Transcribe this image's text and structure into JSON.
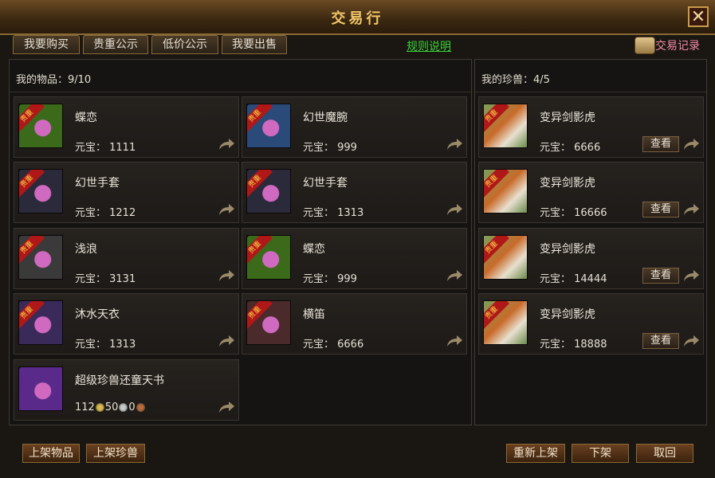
{
  "window": {
    "title": "交易行",
    "close_label": "✕"
  },
  "tabs": [
    {
      "label": "我要购买"
    },
    {
      "label": "贵重公示"
    },
    {
      "label": "低价公示"
    },
    {
      "label": "我要出售"
    }
  ],
  "rules_label": "规则说明",
  "records_label": "交易记录",
  "my_items": {
    "header": "我的物品：9/10",
    "items": [
      {
        "name": "蝶恋",
        "price": "元宝： 1111",
        "badge": "贵重",
        "icon": "pink-gem-pendant-icon",
        "color": "#3a6a1a"
      },
      {
        "name": "幻世魔腕",
        "price": "元宝： 999",
        "badge": "贵重",
        "icon": "bracer-icon",
        "color": "#2a4a7a"
      },
      {
        "name": "幻世手套",
        "price": "元宝： 1212",
        "badge": "贵重",
        "icon": "gauntlet-icon",
        "color": "#2a2a3a"
      },
      {
        "name": "幻世手套",
        "price": "元宝： 1313",
        "badge": "贵重",
        "icon": "gauntlet-icon",
        "color": "#2a2a3a"
      },
      {
        "name": "浅浪",
        "price": "元宝： 3131",
        "badge": "贵重",
        "icon": "scroll-charm-icon",
        "color": "#3a3a3a"
      },
      {
        "name": "蝶恋",
        "price": "元宝： 999",
        "badge": "贵重",
        "icon": "pink-gem-pendant-icon",
        "color": "#3a6a1a"
      },
      {
        "name": "沐水天衣",
        "price": "元宝： 1313",
        "badge": "贵重",
        "icon": "armor-robe-icon",
        "color": "#3a2a5a"
      },
      {
        "name": "横笛",
        "price": "元宝： 6666",
        "badge": "贵重",
        "icon": "flute-ring-icon",
        "color": "#4a2a2a"
      },
      {
        "name": "超级珍兽还童天书",
        "price_parts": [
          "112",
          "50",
          "0"
        ],
        "icon": "purple-book-icon",
        "color": "#5a2a8a"
      }
    ]
  },
  "my_pets": {
    "header": "我的珍兽：4/5",
    "view_label": "查看",
    "pets": [
      {
        "name": "变异剑影虎",
        "price": "元宝： 6666",
        "badge": "贵重",
        "icon": "tiger-pet-icon"
      },
      {
        "name": "变异剑影虎",
        "price": "元宝： 16666",
        "badge": "贵重",
        "icon": "tiger-pet-icon"
      },
      {
        "name": "变异剑影虎",
        "price": "元宝： 14444",
        "badge": "贵重",
        "icon": "tiger-pet-icon"
      },
      {
        "name": "变异剑影虎",
        "price": "元宝： 18888",
        "badge": "贵重",
        "icon": "tiger-pet-icon"
      }
    ]
  },
  "bottom_buttons": {
    "list_item": "上架物品",
    "list_pet": "上架珍兽",
    "relist": "重新上架",
    "delist": "下架",
    "cancel": "取回"
  },
  "colors": {
    "accent": "#f2c66a",
    "rules_link": "#3bd13b",
    "records": "#f08aa6",
    "badge_red": "#b01818"
  }
}
